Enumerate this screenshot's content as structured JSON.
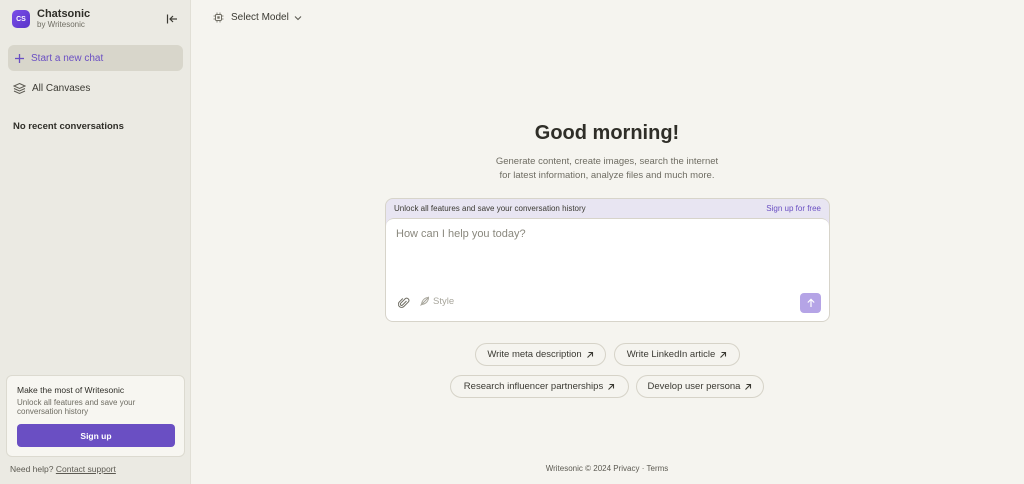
{
  "sidebar": {
    "brand_name": "Chatsonic",
    "brand_sub": "by Writesonic",
    "logo_text": "CS",
    "new_chat_label": "Start a new chat",
    "canvases_label": "All Canvases",
    "no_recent": "No recent conversations",
    "promo": {
      "title": "Make the most of Writesonic",
      "description": "Unlock all features and save your conversation history",
      "signup_label": "Sign up"
    },
    "help_text": "Need help?",
    "help_link": "Contact support"
  },
  "header": {
    "model_select_label": "Select Model"
  },
  "main": {
    "greeting": "Good morning!",
    "subtitle_line1": "Generate content, create images, search the internet",
    "subtitle_line2": "for latest information, analyze files and much more.",
    "banner_text": "Unlock all features and save your conversation history",
    "banner_link": "Sign up for free",
    "input_placeholder": "How can I help you today?",
    "input_value": "",
    "style_label": "Style",
    "suggestions": [
      "Write meta description",
      "Write LinkedIn article",
      "Research influencer partnerships",
      "Develop user persona"
    ]
  },
  "footer": {
    "copyright": "Writesonic © 2024",
    "privacy": "Privacy",
    "separator": "·",
    "terms": "Terms"
  },
  "colors": {
    "accent": "#6a4fc3",
    "send_button": "#b5a4e6",
    "sidebar_bg": "#ebeae3",
    "main_bg": "#f5f4ef"
  },
  "icons": {
    "collapse": "collapse-sidebar-icon",
    "new_chat": "plus-icon",
    "canvases": "layers-icon",
    "model": "chip-icon",
    "chevron": "chevron-down-icon",
    "attach": "paperclip-icon",
    "style": "feather-icon",
    "send": "arrow-up-icon",
    "suggestion": "arrow-up-right-icon"
  }
}
